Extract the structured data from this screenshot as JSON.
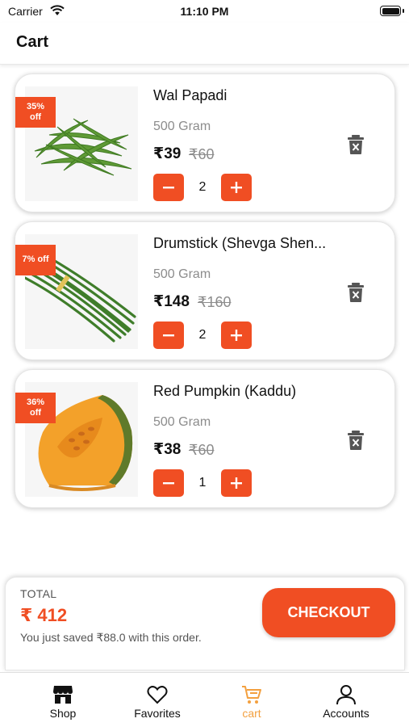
{
  "status_bar": {
    "carrier": "Carrier",
    "time": "11:10 PM"
  },
  "header": {
    "title": "Cart"
  },
  "cart_items": [
    {
      "name": "Wal Papadi",
      "weight": "500 Gram",
      "price": "₹39",
      "mrp": "₹60",
      "discount": [
        "35%",
        "off"
      ],
      "quantity": "2"
    },
    {
      "name": "Drumstick (Shevga Shen...",
      "weight": "500 Gram",
      "price": "₹148",
      "mrp": "₹160",
      "discount": [
        "7% off"
      ],
      "quantity": "2"
    },
    {
      "name": "Red Pumpkin (Kaddu)",
      "weight": "500 Gram",
      "price": "₹38",
      "mrp": "₹60",
      "discount": [
        "36%",
        "off"
      ],
      "quantity": "1"
    }
  ],
  "summary": {
    "total_label": "TOTAL",
    "total_amount": "₹ 412",
    "savings_text": "You just saved ₹88.0 with this order.",
    "checkout_label": "CHECKOUT"
  },
  "tab_bar": {
    "tabs": [
      {
        "label": "Shop",
        "icon": "shop-icon",
        "active": false
      },
      {
        "label": "Favorites",
        "icon": "heart-icon",
        "active": false
      },
      {
        "label": "cart",
        "icon": "cart-icon",
        "active": true
      },
      {
        "label": "Accounts",
        "icon": "account-icon",
        "active": false
      }
    ]
  },
  "colors": {
    "accent": "#f04e23",
    "active_tab": "#f3a03f",
    "muted_text": "#8c8c8c"
  }
}
